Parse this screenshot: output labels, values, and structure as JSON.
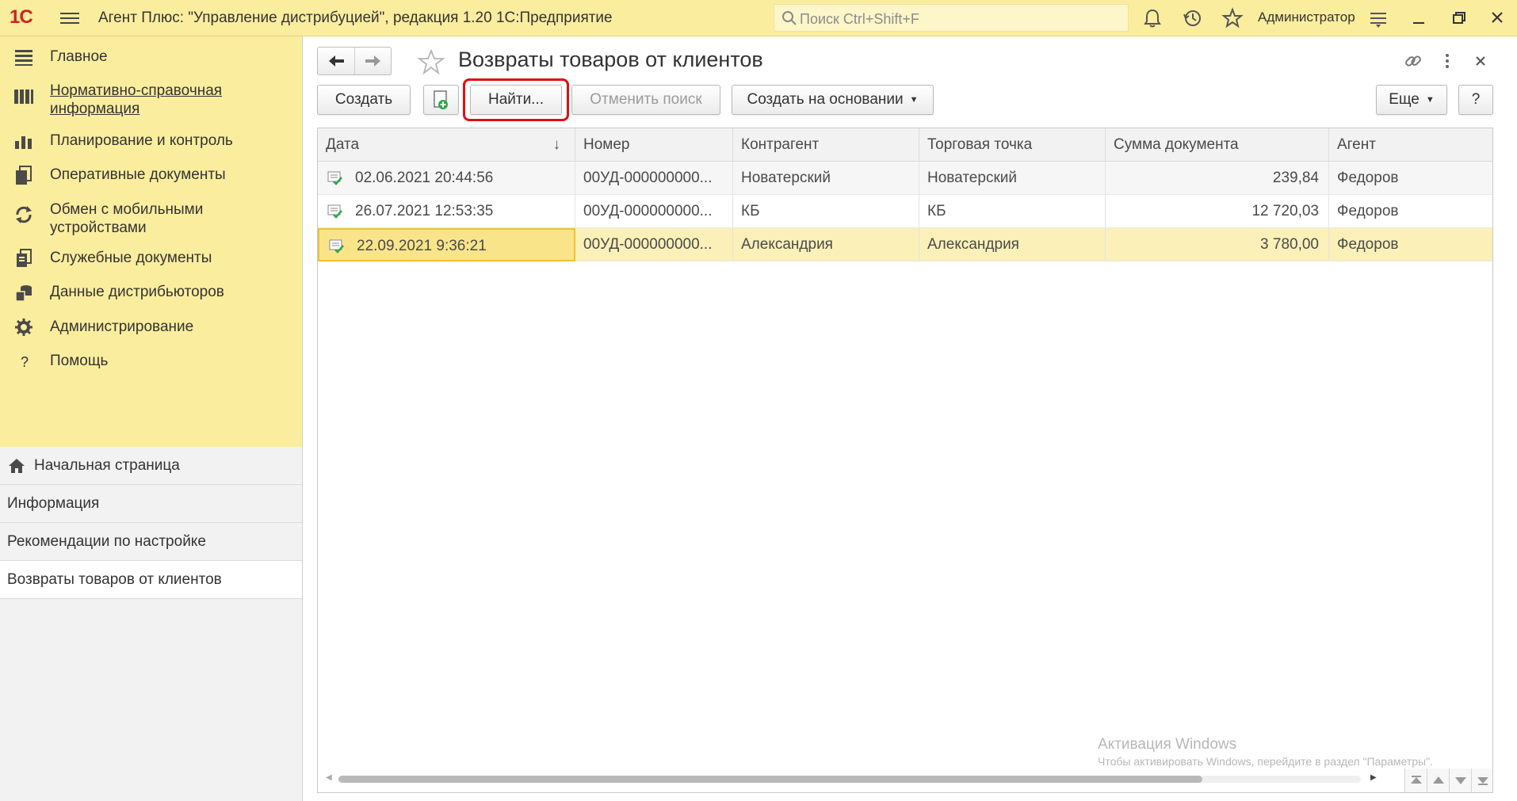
{
  "titlebar": {
    "logo": "1С",
    "app_title": "Агент Плюс: \"Управление дистрибуцией\", редакция 1.20 1С:Предприятие",
    "search_placeholder": "Поиск Ctrl+Shift+F",
    "user": "Администратор"
  },
  "sidebar": {
    "sections": [
      {
        "label": "Главное",
        "icon": "list-icon"
      },
      {
        "label": "Нормативно-справочная информация",
        "icon": "books-icon"
      },
      {
        "label": "Планирование и контроль",
        "icon": "bar-chart-icon"
      },
      {
        "label": "Оперативные документы",
        "icon": "documents-icon"
      },
      {
        "label": "Обмен с мобильными устройствами",
        "icon": "sync-icon"
      },
      {
        "label": "Служебные документы",
        "icon": "service-docs-icon"
      },
      {
        "label": "Данные дистрибьюторов",
        "icon": "distributor-icon"
      },
      {
        "label": "Администрирование",
        "icon": "gear-icon"
      },
      {
        "label": "Помощь",
        "icon": "question-icon"
      }
    ],
    "open_windows": [
      {
        "label": "Начальная страница",
        "icon": "home-icon"
      },
      {
        "label": "Информация"
      },
      {
        "label": "Рекомендации по настройке"
      },
      {
        "label": "Возвраты товаров от клиентов",
        "active": true
      }
    ]
  },
  "form": {
    "title": "Возвраты товаров от клиентов",
    "buttons": {
      "create": "Создать",
      "find": "Найти...",
      "cancel_search": "Отменить поиск",
      "create_based_on": "Создать на основании",
      "more": "Еще",
      "help": "?"
    },
    "table": {
      "columns": [
        "Дата",
        "Номер",
        "Контрагент",
        "Торговая точка",
        "Сумма документа",
        "Агент"
      ],
      "rows": [
        {
          "date": "02.06.2021 20:44:56",
          "number": "00УД-000000000...",
          "counterparty": "Новатерский",
          "outlet": "Новатерский",
          "sum": "239,84",
          "agent": "Федоров"
        },
        {
          "date": "26.07.2021 12:53:35",
          "number": "00УД-000000000...",
          "counterparty": "КБ",
          "outlet": "КБ",
          "sum": "12 720,03",
          "agent": "Федоров"
        },
        {
          "date": "22.09.2021 9:36:21",
          "number": "00УД-000000000...",
          "counterparty": "Александрия",
          "outlet": "Александрия",
          "sum": "3 780,00",
          "agent": "Федоров"
        }
      ],
      "selected_row": 2
    }
  },
  "watermark": {
    "line1": "Активация Windows",
    "line2": "Чтобы активировать Windows, перейдите в раздел \"Параметры\"."
  },
  "colors": {
    "section_panel": "#fbed9e",
    "selected_row": "#fbf0b8",
    "focused_cell": "#f9e48a",
    "find_highlight": "#e00f0f",
    "logo": "#d22020"
  }
}
